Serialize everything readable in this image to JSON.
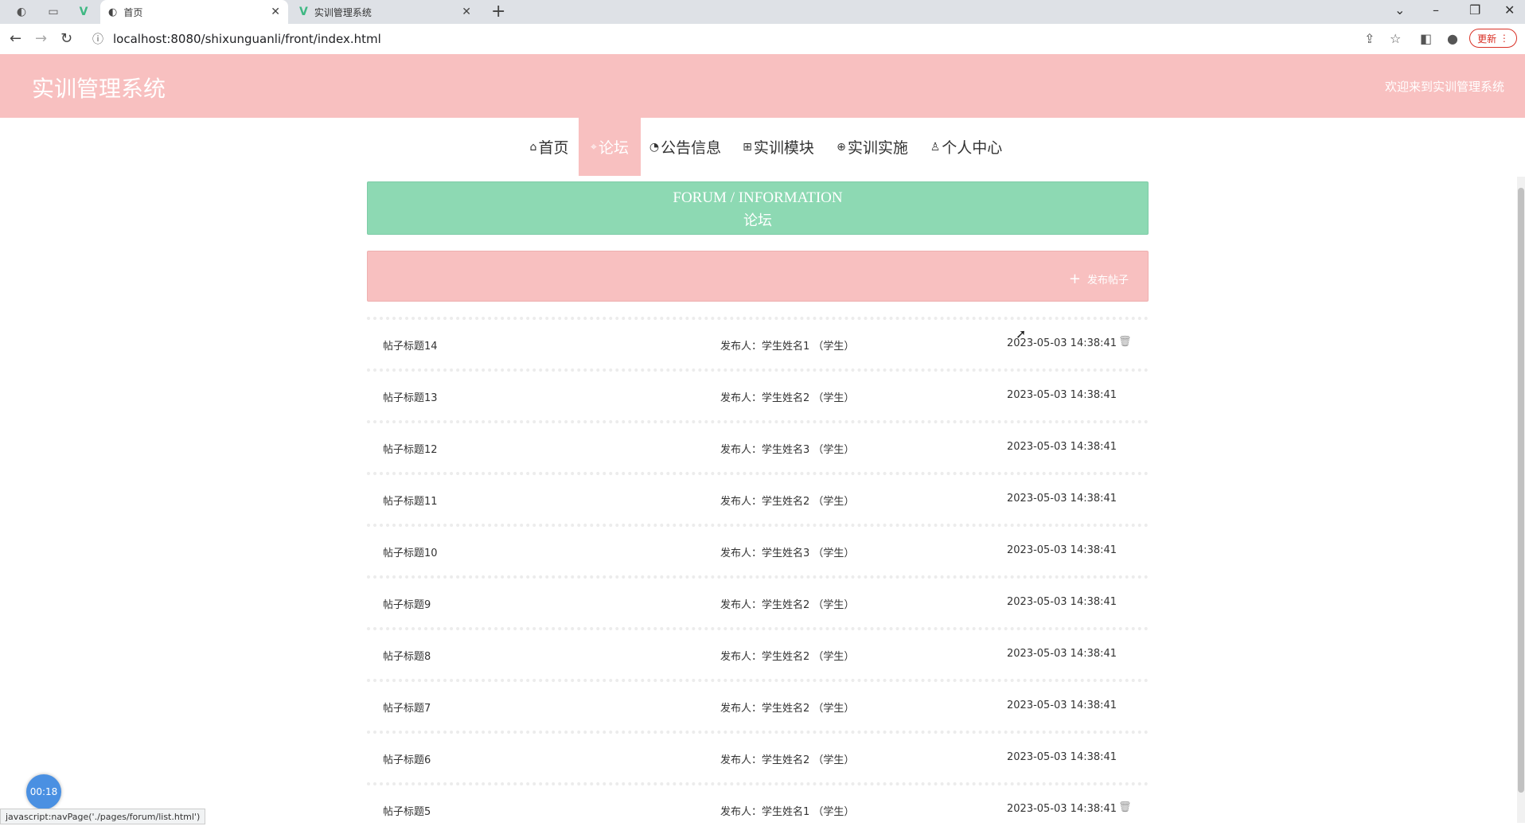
{
  "browser": {
    "tabs": [
      {
        "title": "首页",
        "close": "✕"
      },
      {
        "title": "实训管理系统",
        "close": "✕"
      }
    ],
    "new_tab": "+",
    "url": "localhost:8080/shixunguanli/front/index.html",
    "update_label": "更新",
    "status_text": "javascript:navPage('./pages/forum/list.html')"
  },
  "header": {
    "site_title": "实训管理系统",
    "welcome": "欢迎来到实训管理系统"
  },
  "nav": {
    "items": [
      {
        "icon": "home-icon",
        "label": "首页"
      },
      {
        "icon": "tag-icon",
        "label": "论坛"
      },
      {
        "icon": "gauge-icon",
        "label": "公告信息"
      },
      {
        "icon": "book-icon",
        "label": "实训模块"
      },
      {
        "icon": "gift-icon",
        "label": "实训实施"
      },
      {
        "icon": "user-icon",
        "label": "个人中心"
      }
    ],
    "active": "论坛"
  },
  "forum": {
    "title_en": "FORUM / INFORMATION",
    "title_cn": "论坛",
    "publish_label": "发布帖子"
  },
  "posts": [
    {
      "title": "帖子标题14",
      "author": "发布人：学生姓名1 （学生）",
      "time": "2023-05-03 14:38:41",
      "deletable": true
    },
    {
      "title": "帖子标题13",
      "author": "发布人：学生姓名2 （学生）",
      "time": "2023-05-03 14:38:41",
      "deletable": false
    },
    {
      "title": "帖子标题12",
      "author": "发布人：学生姓名3 （学生）",
      "time": "2023-05-03 14:38:41",
      "deletable": false
    },
    {
      "title": "帖子标题11",
      "author": "发布人：学生姓名2 （学生）",
      "time": "2023-05-03 14:38:41",
      "deletable": false
    },
    {
      "title": "帖子标题10",
      "author": "发布人：学生姓名3 （学生）",
      "time": "2023-05-03 14:38:41",
      "deletable": false
    },
    {
      "title": "帖子标题9",
      "author": "发布人：学生姓名2 （学生）",
      "time": "2023-05-03 14:38:41",
      "deletable": false
    },
    {
      "title": "帖子标题8",
      "author": "发布人：学生姓名2 （学生）",
      "time": "2023-05-03 14:38:41",
      "deletable": false
    },
    {
      "title": "帖子标题7",
      "author": "发布人：学生姓名2 （学生）",
      "time": "2023-05-03 14:38:41",
      "deletable": false
    },
    {
      "title": "帖子标题6",
      "author": "发布人：学生姓名2 （学生）",
      "time": "2023-05-03 14:38:41",
      "deletable": false
    },
    {
      "title": "帖子标题5",
      "author": "发布人：学生姓名1 （学生）",
      "time": "2023-05-03 14:38:41",
      "deletable": true
    }
  ],
  "overlay": {
    "timer": "00:18"
  },
  "colors": {
    "brand_pink": "#f8c0c0",
    "banner_green": "#8dd9b3"
  }
}
